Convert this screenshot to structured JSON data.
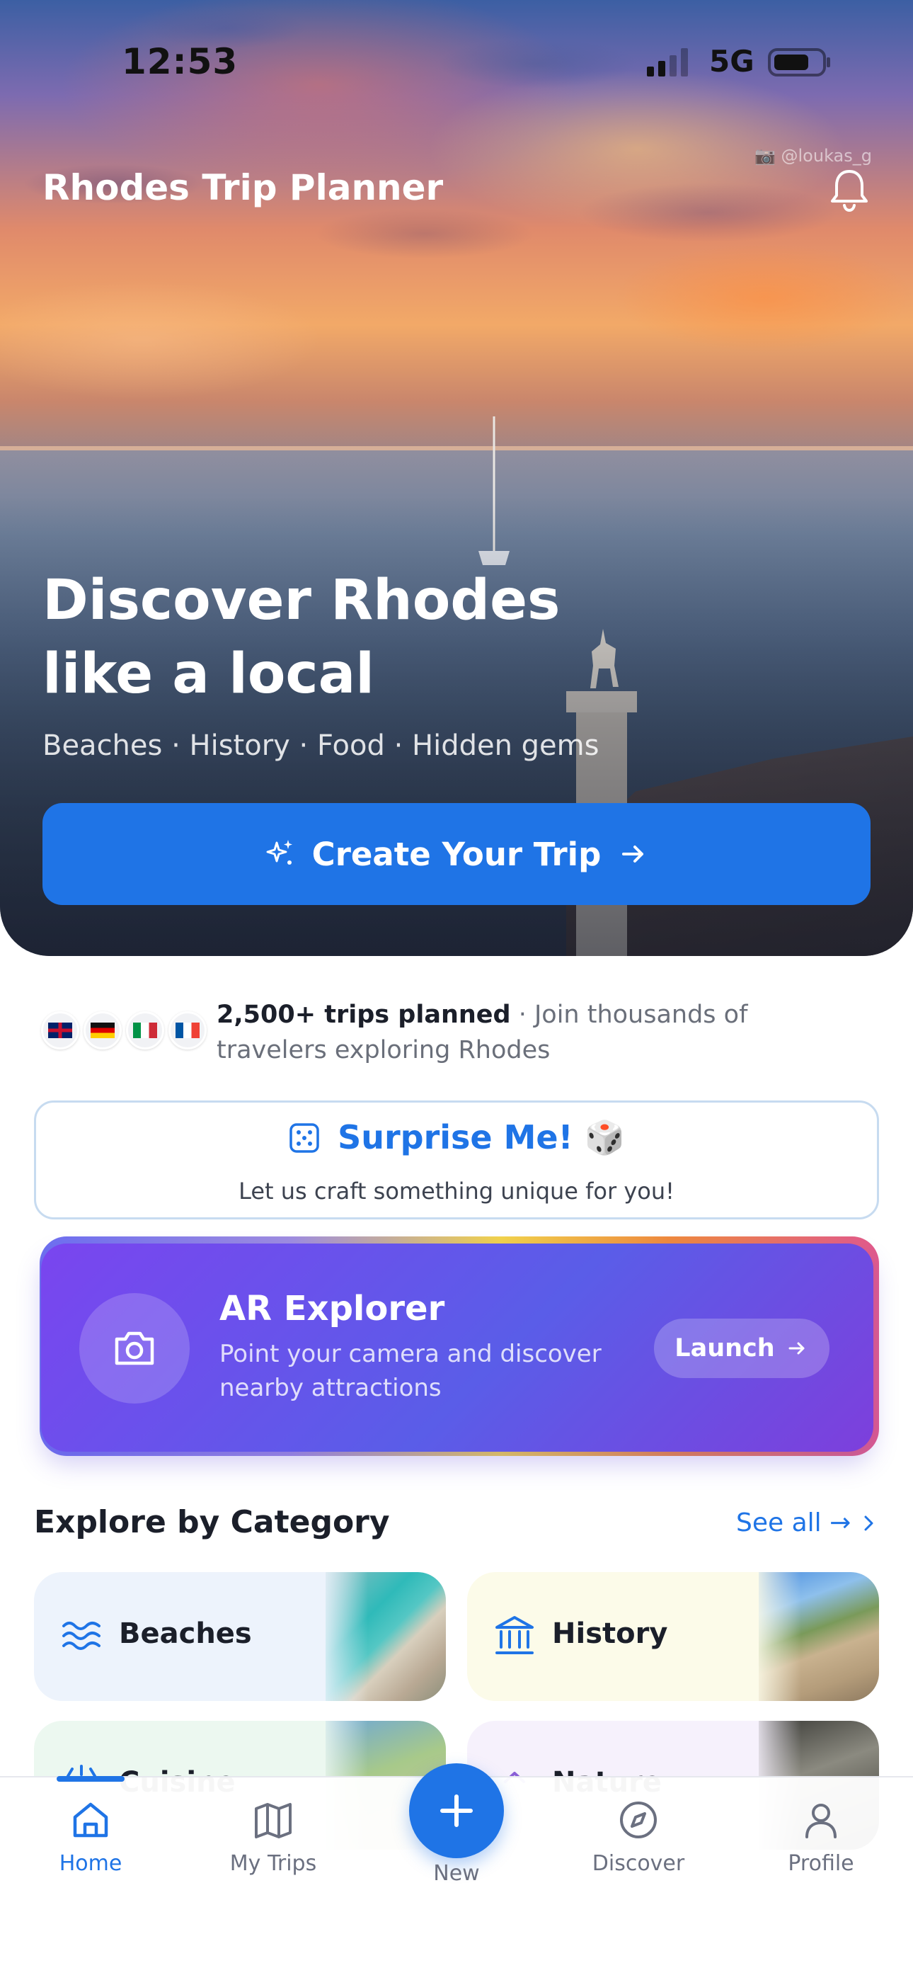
{
  "status_bar": {
    "time": "12:53",
    "network": "5G"
  },
  "header": {
    "photo_credit": "📷 @loukas_g",
    "title": "Rhodes Trip Planner"
  },
  "hero": {
    "headline": "Discover Rhodes like a local",
    "tagline": "Beaches · History · Food · Hidden gems",
    "cta_label": "Create Your Trip"
  },
  "social_proof": {
    "flags": [
      "uk-flag",
      "germany-flag",
      "italy-flag",
      "france-flag"
    ],
    "highlight": "2,500+ trips planned",
    "text": " · Join thousands of travelers exploring Rhodes"
  },
  "surprise": {
    "title": "Surprise Me! 🎲",
    "subtitle": "Let us craft something unique for you!"
  },
  "ar_explorer": {
    "title": "AR Explorer",
    "description": "Point your camera and discover nearby attractions",
    "button_label": "Launch"
  },
  "categories_section": {
    "title": "Explore by Category",
    "see_all": "See all →",
    "items": [
      {
        "label": "Beaches",
        "icon": "waves-icon"
      },
      {
        "label": "History",
        "icon": "landmark-icon"
      },
      {
        "label": "Cuisine",
        "icon": "food-icon"
      },
      {
        "label": "Nature",
        "icon": "nature-icon"
      }
    ]
  },
  "bottom_nav": {
    "items": [
      {
        "label": "Home",
        "icon": "home-icon",
        "active": true
      },
      {
        "label": "My Trips",
        "icon": "map-icon"
      },
      {
        "label": "New",
        "icon": "plus-icon"
      },
      {
        "label": "Discover",
        "icon": "compass-icon"
      },
      {
        "label": "Profile",
        "icon": "user-icon"
      }
    ]
  },
  "colors": {
    "primary": "#1f74e6",
    "ar_gradient_start": "#7a45ef",
    "ar_gradient_end": "#5a5de8"
  }
}
